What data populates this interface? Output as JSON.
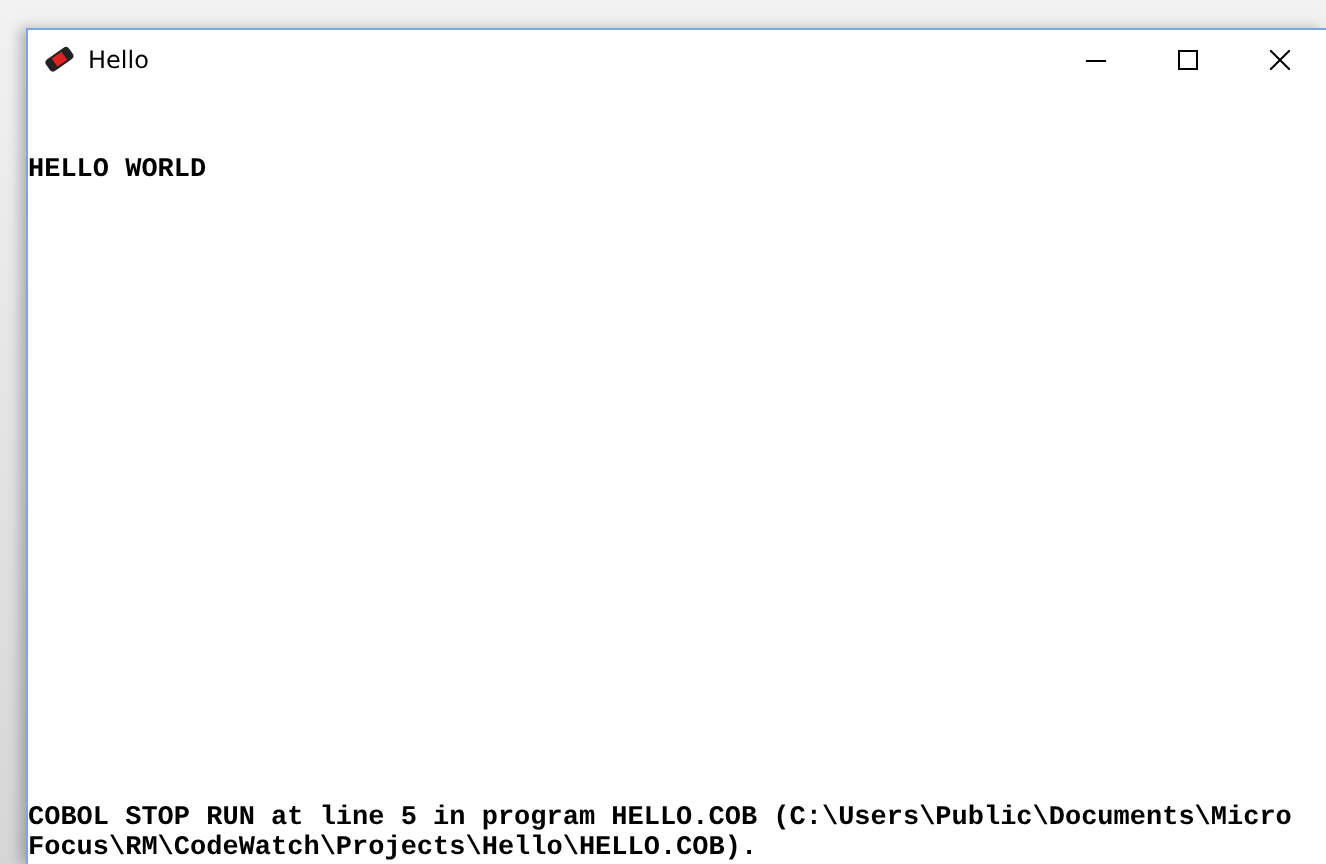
{
  "window": {
    "title": "Hello"
  },
  "console": {
    "top_lines": [
      "HELLO WORLD"
    ],
    "bottom_lines": [
      "COBOL STOP RUN at line 5 in program HELLO.COB (C:\\Users\\Public\\Documents\\Micro",
      "Focus\\RM\\CodeWatch\\Projects\\Hello\\HELLO.COB)."
    ]
  }
}
